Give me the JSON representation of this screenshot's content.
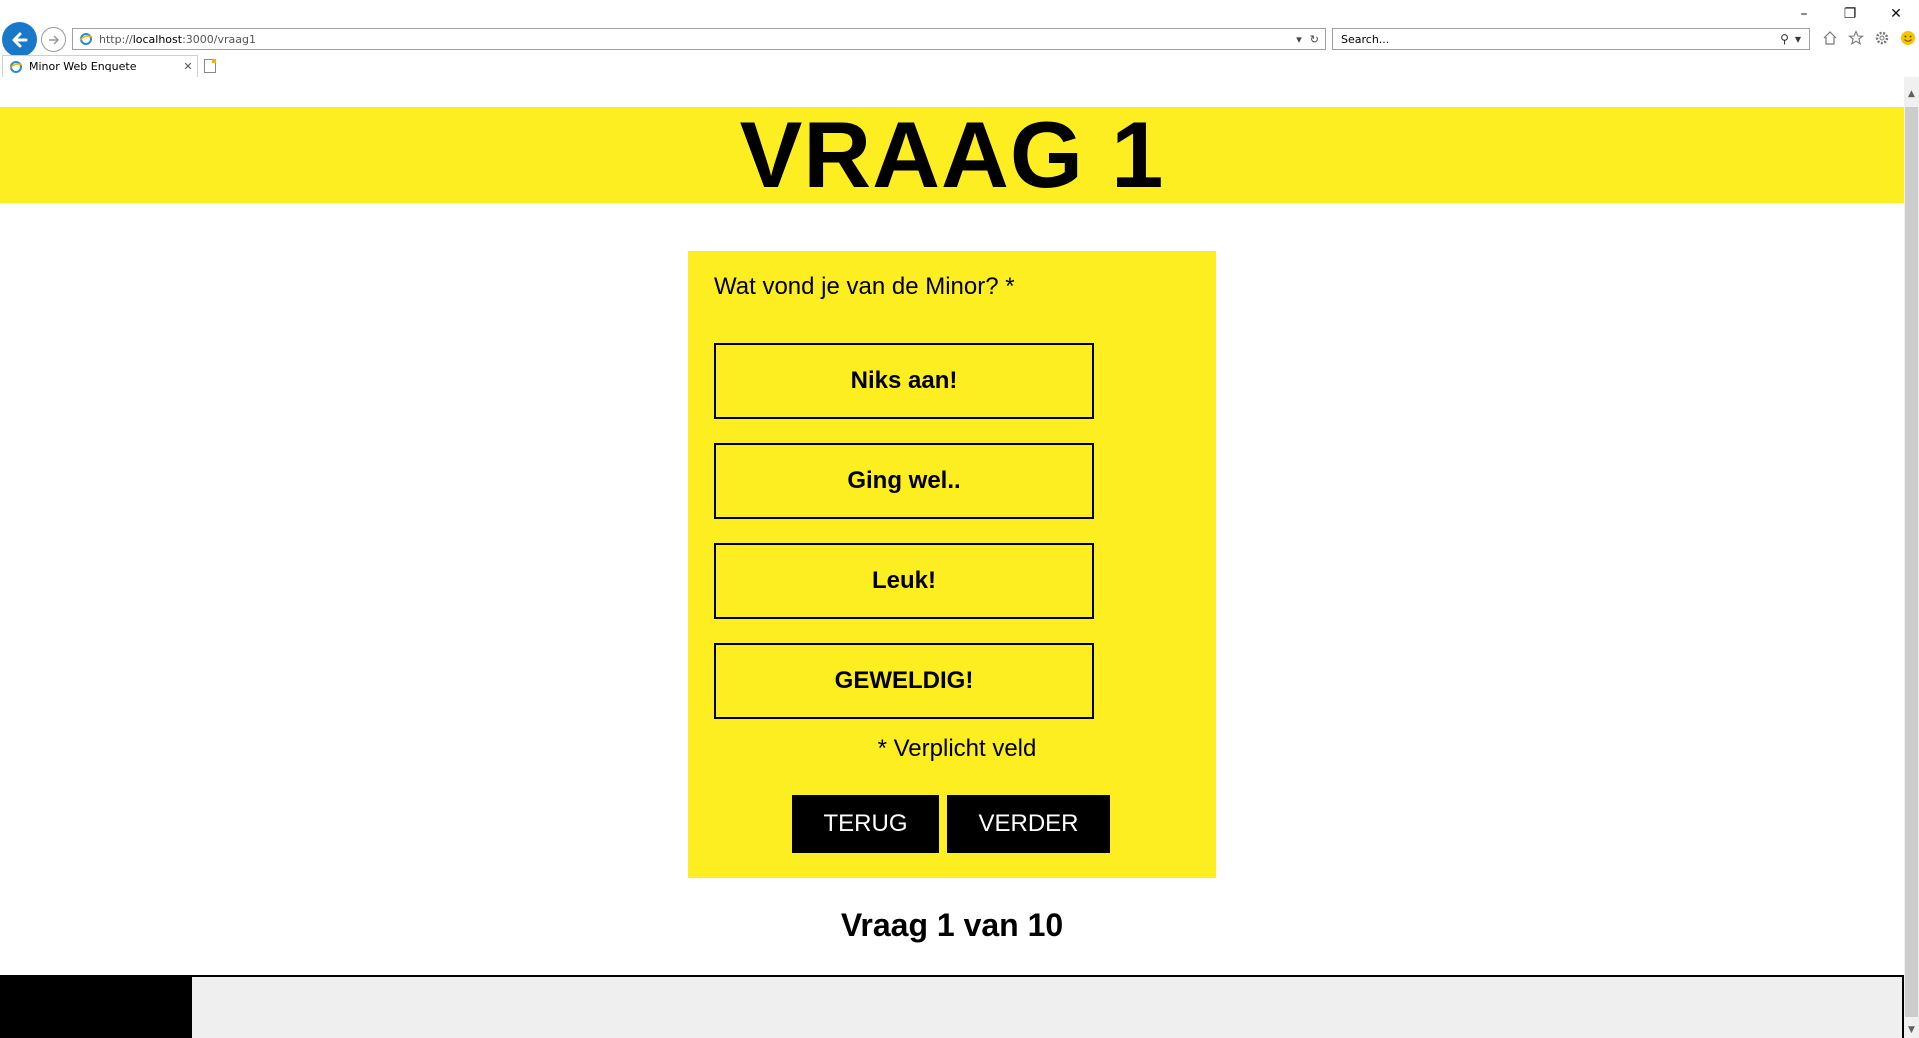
{
  "browser": {
    "window_controls": {
      "minimize": "–",
      "restore": "❐",
      "close": "✕"
    },
    "address": {
      "prefix": "http://",
      "host": "localhost",
      "path": ":3000/vraag1"
    },
    "search": {
      "placeholder": "Search..."
    },
    "tab": {
      "title": "Minor Web Enquete",
      "close": "✕"
    },
    "toolbar_icons": [
      "home-icon",
      "star-icon",
      "gear-icon",
      "smiley-icon"
    ]
  },
  "page": {
    "title": "VRAAG 1",
    "question": "Wat vond je van de Minor? *",
    "options": [
      "Niks aan!",
      "Ging wel..",
      "Leuk!",
      "GEWELDIG!"
    ],
    "required_note": "* Verplicht veld",
    "back_button": "TERUG",
    "next_button": "VERDER",
    "progress_text": "Vraag 1 van 10"
  },
  "colors": {
    "accent": "#fdee21",
    "text": "#000000",
    "button_bg": "#000000",
    "button_text": "#ffffff"
  }
}
